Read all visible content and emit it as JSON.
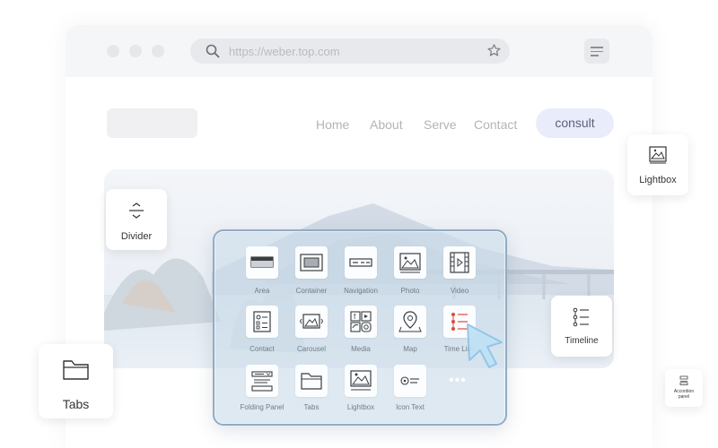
{
  "browser": {
    "url": "https://weber.top.com"
  },
  "site": {
    "nav": [
      "Home",
      "About",
      "Serve",
      "Contact"
    ],
    "cta": "consult"
  },
  "panel": {
    "components": [
      {
        "label": "Area",
        "icon": "area-icon"
      },
      {
        "label": "Container",
        "icon": "container-icon"
      },
      {
        "label": "Navigation",
        "icon": "navigation-icon"
      },
      {
        "label": "Photo",
        "icon": "photo-icon"
      },
      {
        "label": "Video",
        "icon": "video-icon"
      },
      {
        "label": "Contact",
        "icon": "contact-icon"
      },
      {
        "label": "Carousel",
        "icon": "carousel-icon"
      },
      {
        "label": "Media",
        "icon": "media-icon"
      },
      {
        "label": "Map",
        "icon": "map-pin-icon"
      },
      {
        "label": "Time Line",
        "icon": "timeline-icon"
      },
      {
        "label": "Folding Panel",
        "icon": "folding-panel-icon"
      },
      {
        "label": "Tabs",
        "icon": "folder-icon"
      },
      {
        "label": "Lightbox",
        "icon": "lightbox-icon"
      },
      {
        "label": "Icon Text",
        "icon": "icon-text-icon"
      }
    ],
    "more": "•••"
  },
  "cards": {
    "divider": "Divider",
    "lightbox": "Lightbox",
    "timeline": "Timeline",
    "tabs": "Tabs",
    "accordion": "Accordion panel"
  },
  "colors": {
    "accent": "#e9ecfb",
    "timeline_red": "#e0473c",
    "cursor": "#a9d4ee"
  }
}
